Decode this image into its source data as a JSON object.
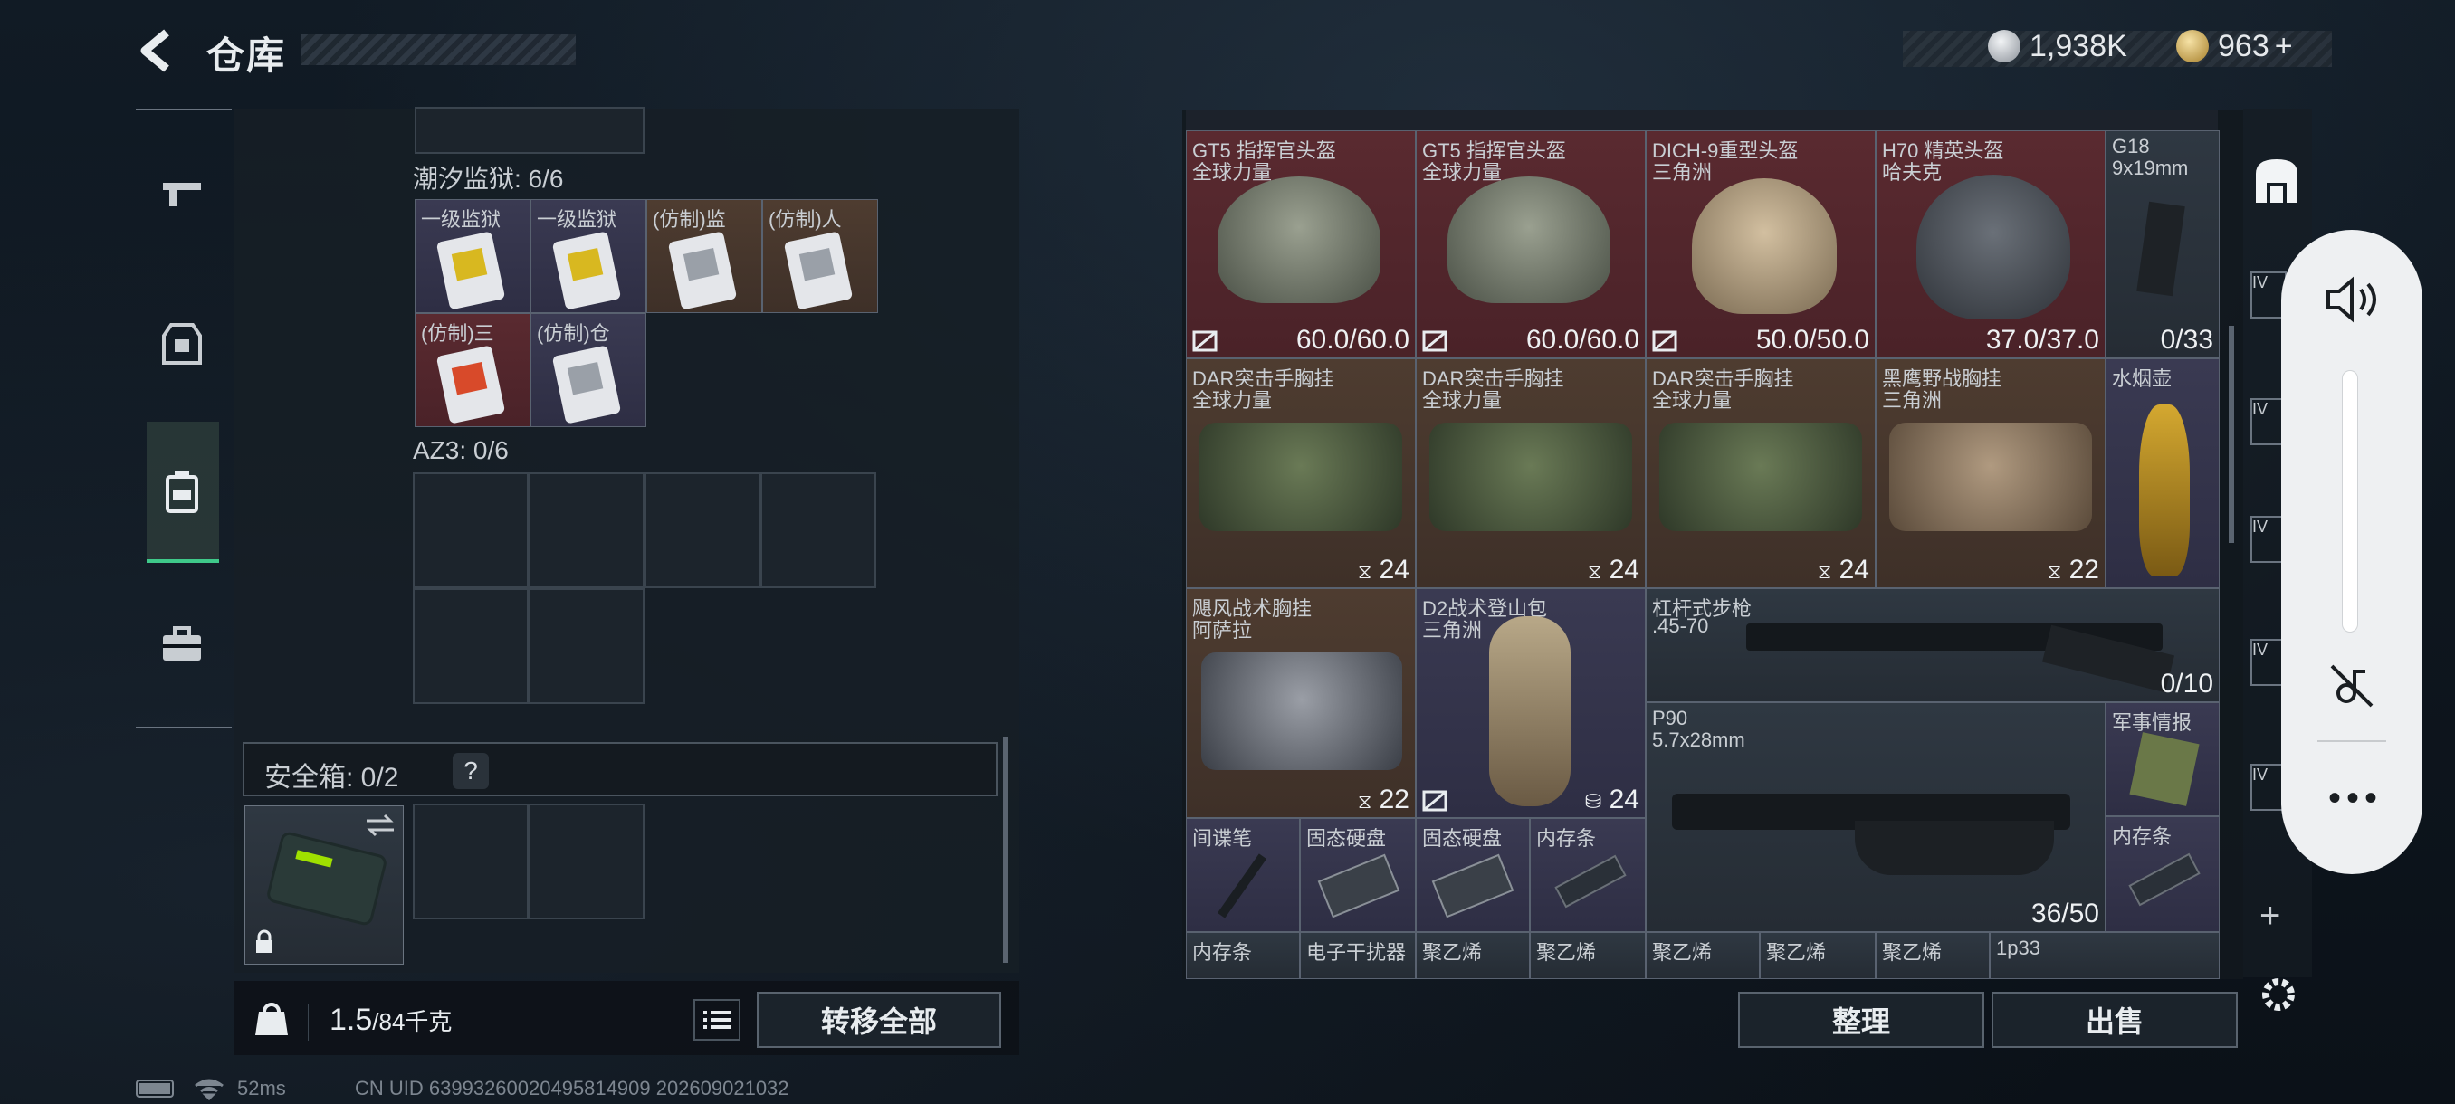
{
  "header": {
    "title": "仓库",
    "currency1": "1,938K",
    "currency2": "963",
    "plus": "+"
  },
  "left": {
    "section1_label": "潮汐监狱: 6/6",
    "tiles": [
      {
        "name": "一级监狱"
      },
      {
        "name": "一级监狱"
      },
      {
        "name": "(仿制)监"
      },
      {
        "name": "(仿制)人"
      },
      {
        "name": "(仿制)三"
      },
      {
        "name": "(仿制)仓"
      }
    ],
    "section2_label": "AZ3: 0/6",
    "safe_label": "安全箱: 0/2",
    "safe_help": "?",
    "weight_value": "1.5",
    "weight_cap": "/84千克",
    "transfer_all": "转移全部"
  },
  "right": {
    "items": [
      {
        "name": "GT5 指挥官头盔",
        "sub": "全球力量",
        "value": "60.0/60.0"
      },
      {
        "name": "GT5 指挥官头盔",
        "sub": "全球力量",
        "value": "60.0/60.0"
      },
      {
        "name": "DICH-9重型头盔",
        "sub": "三角洲",
        "value": "50.0/50.0"
      },
      {
        "name": "H70 精英头盔",
        "sub": "哈夫克",
        "value": "37.0/37.0"
      },
      {
        "name": "G18",
        "sub": "9x19mm",
        "value": "0/33"
      },
      {
        "name": "DAR突击手胸挂",
        "sub": "全球力量",
        "value": "24"
      },
      {
        "name": "DAR突击手胸挂",
        "sub": "全球力量",
        "value": "24"
      },
      {
        "name": "DAR突击手胸挂",
        "sub": "全球力量",
        "value": "24"
      },
      {
        "name": "黑鹰野战胸挂",
        "sub": "三角洲",
        "value": "22"
      },
      {
        "name": "水烟壶",
        "sub": "",
        "value": ""
      },
      {
        "name": "飓风战术胸挂",
        "sub": "阿萨拉",
        "value": "22"
      },
      {
        "name": "D2战术登山包",
        "sub": "三角洲",
        "value": "24"
      },
      {
        "name": "杠杆式步枪",
        "sub": ".45-70",
        "value": "0/10"
      },
      {
        "name": "P90",
        "sub": "5.7x28mm",
        "value": "36/50"
      },
      {
        "name": "军事情报",
        "sub": "",
        "value": ""
      },
      {
        "name": "间谍笔",
        "sub": "",
        "value": ""
      },
      {
        "name": "固态硬盘",
        "sub": "",
        "value": ""
      },
      {
        "name": "固态硬盘",
        "sub": "",
        "value": ""
      },
      {
        "name": "内存条",
        "sub": "",
        "value": ""
      },
      {
        "name": "内存条",
        "sub": "",
        "value": ""
      },
      {
        "name": "内存条",
        "sub": "",
        "value": ""
      },
      {
        "name": "电子干扰器",
        "sub": "",
        "value": ""
      },
      {
        "name": "聚乙烯",
        "sub": "",
        "value": ""
      },
      {
        "name": "聚乙烯",
        "sub": "",
        "value": ""
      },
      {
        "name": "聚乙烯",
        "sub": "",
        "value": ""
      },
      {
        "name": "聚乙烯",
        "sub": "",
        "value": ""
      },
      {
        "name": "聚乙烯",
        "sub": "",
        "value": ""
      },
      {
        "name": "1p33",
        "sub": "",
        "value": ""
      }
    ],
    "sort": "整理",
    "sell": "出售"
  },
  "status": {
    "ping": "52ms",
    "uid": "CN UID 6399326002049581490​9 202609021032"
  },
  "colors": {
    "accent": "#3fc98a",
    "red_rarity": "#5a2a30",
    "brown_rarity": "#4e3c30",
    "purple_rarity": "#3a3a52"
  }
}
